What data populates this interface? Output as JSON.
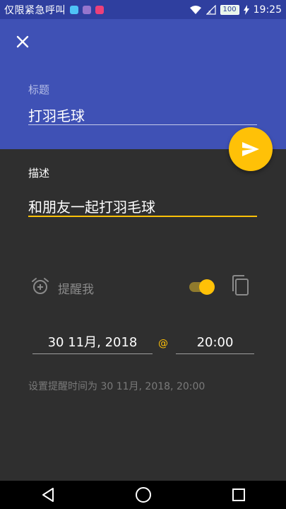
{
  "status_bar": {
    "carrier": "仅限紧急呼叫",
    "battery": "100",
    "time": "19:25"
  },
  "header": {
    "title_label": "标题",
    "title_value": "打羽毛球"
  },
  "description": {
    "label": "描述",
    "value": "和朋友一起打羽毛球"
  },
  "reminder": {
    "label": "提醒我",
    "enabled": true
  },
  "schedule": {
    "date": "30 11月, 2018",
    "at": "@",
    "time": "20:00",
    "summary": "设置提醒时间为 30 11月, 2018, 20:00"
  },
  "colors": {
    "primary": "#3f51b5",
    "status_bar": "#2f3f9f",
    "accent": "#ffc107",
    "background": "#2f2f2f"
  },
  "icons": {
    "close": "close-icon",
    "send": "send-icon",
    "alarm": "alarm-add-icon",
    "copy": "copy-icon"
  }
}
